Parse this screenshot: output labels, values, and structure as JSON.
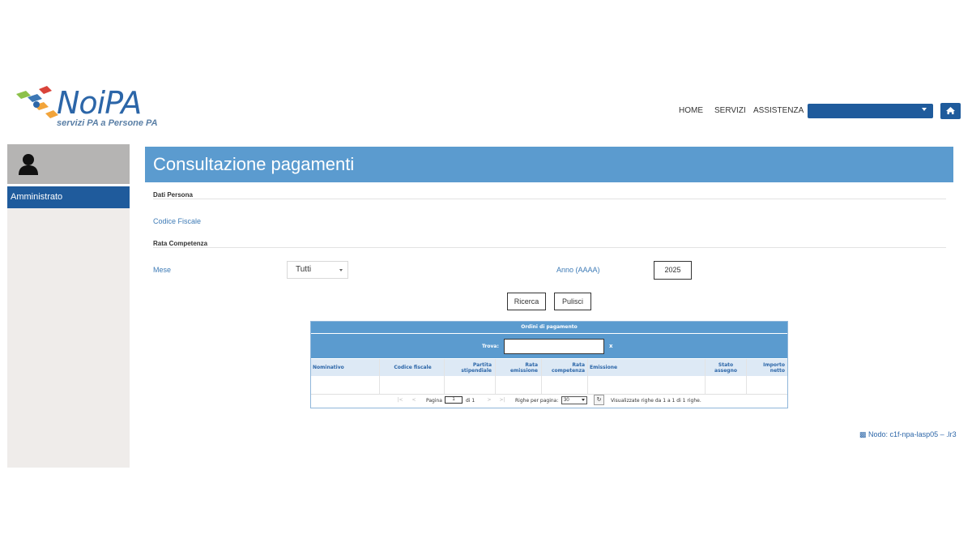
{
  "brand": {
    "name": "NoiPA",
    "tagline": "servizi PA a Persone PA"
  },
  "nav": {
    "home": "HOME",
    "servizi": "SERVIZI",
    "assistenza": "ASSISTENZA"
  },
  "sidebar": {
    "item": "Amministrato"
  },
  "page": {
    "title": "Consultazione pagamenti",
    "section_persona": "Dati Persona",
    "codice_fiscale_label": "Codice Fiscale",
    "section_rata": "Rata Competenza",
    "mese_label": "Mese",
    "mese_value": "Tutti",
    "anno_label": "Anno (AAAA)",
    "anno_value": "2025",
    "ricerca": "Ricerca",
    "pulisci": "Pulisci"
  },
  "grid": {
    "title": "Ordini di pagamento",
    "trova_label": "Trova:",
    "clear_symbol": "x",
    "columns": [
      "Nominativo",
      "Codice fiscale",
      "Partita stipendiale",
      "Rata emissione",
      "Rata competenza",
      "Emissione",
      "Stato assegno",
      "Importo netto"
    ],
    "pager": {
      "pagina_label": "Pagina",
      "page": "1",
      "of_label": "di 1",
      "rows_label": "Righe per pagina:",
      "rows_value": "30",
      "summary": "Visualizzate righe da 1 a 1 di 1 righe."
    }
  },
  "footer": {
    "nodo": "Nodo: c1f-npa-lasp05 – .lr3"
  },
  "colors": {
    "primary": "#1f5b9c",
    "accent": "#5b9bcf",
    "sidebar": "#efecea"
  }
}
